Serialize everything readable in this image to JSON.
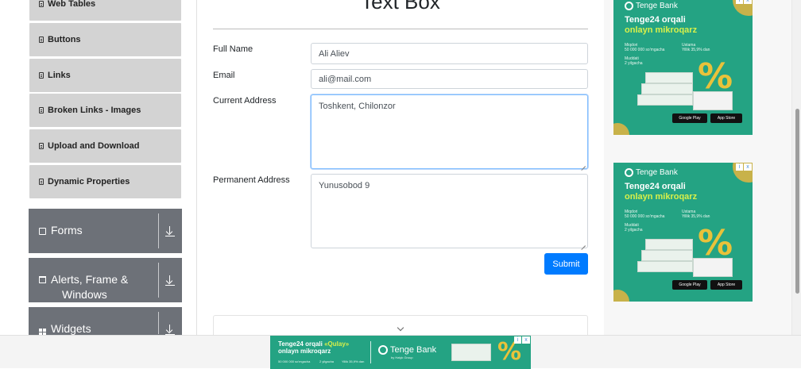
{
  "sidebar": {
    "element_items": [
      "Web Tables",
      "Buttons",
      "Links",
      "Broken Links - Images",
      "Upload and Download",
      "Dynamic Properties"
    ],
    "groups": [
      {
        "label": "Forms"
      },
      {
        "label_line1": "Alerts, Frame &",
        "label_line2": "Windows"
      },
      {
        "label": "Widgets"
      }
    ]
  },
  "form": {
    "title": "Text Box",
    "full_name": {
      "label": "Full Name",
      "value": "Ali Aliev"
    },
    "email": {
      "label": "Email",
      "value": "ali@mail.com"
    },
    "current_address": {
      "label": "Current Address",
      "value": "Toshkent, Chilonzor"
    },
    "permanent_address": {
      "label": "Permanent Address",
      "value": "Yunusobod 9"
    },
    "submit_label": "Submit"
  },
  "ads": {
    "brand": "Tenge Bank",
    "headline_line1": "Tenge24 orqali",
    "headline_line2": "onlayn mikroqarz",
    "detail_1_label": "Miqdori",
    "detail_1_value": "50 000 000 so'mgacha",
    "detail_2_label": "Ustama",
    "detail_2_value": "Yillik 35,9% dan",
    "detail_3_label": "Muddati",
    "detail_3_value": "2 yilgacha",
    "store_1": "Google Play",
    "store_2": "App Store",
    "percent_symbol": "%",
    "adchoices_info": "i",
    "adchoices_close": "x",
    "bottom": {
      "line1_prefix": "Tenge24 orqali ",
      "line1_highlight": "«Qulay»",
      "line2": "onlayn mikroqarz",
      "brand": "Tenge Bank",
      "brand_sub": "by Halyk Group",
      "d1": "50 000 000 so'mgacha",
      "d2": "2 yilgacha",
      "d3": "Yillik 35,9% dan"
    }
  },
  "colors": {
    "primary": "#007bff",
    "sidebar_item": "#d3d3d3",
    "group_header": "#6d7178",
    "ad_green": "#24a383",
    "ad_highlight": "#d8f04a"
  },
  "icons": {
    "element_item": "note-icon",
    "forms": "list-icon",
    "alerts": "window-icon",
    "widgets": "grid-icon",
    "expand": "download-arrow-icon",
    "accordion": "chevron-down-icon"
  }
}
